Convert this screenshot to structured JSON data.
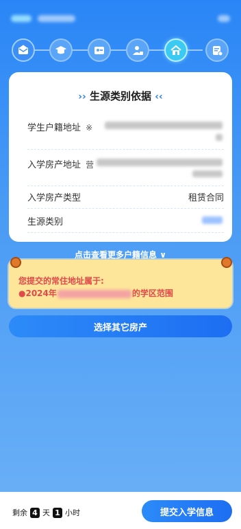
{
  "card": {
    "title": "生源类别依据",
    "rows": [
      {
        "label": "学生户籍地址",
        "value_prefix": "※"
      },
      {
        "label": "入学房产地址",
        "value_prefix": "营"
      },
      {
        "label": "入学房产类型",
        "value": "租赁合同"
      },
      {
        "label": "生源类别"
      }
    ]
  },
  "more_link": "点击查看更多户籍信息 ∨",
  "notice": {
    "line1": "您提交的常住地址属于:",
    "line2_prefix": "●2024年",
    "line2_suffix": "的学区范围"
  },
  "choose_button": "选择其它房产",
  "footer": {
    "remain_label": "剩余",
    "days": "4",
    "day_unit": "天",
    "hours": "1",
    "hour_unit": "小时",
    "submit_button": "提交入学信息"
  },
  "colors": {
    "primary": "#2d8bf8",
    "notice_bg": "#fde59a",
    "notice_text": "#e14a4a",
    "active_step": "#3ccaf3"
  },
  "steps": [
    {
      "icon": "envelope-icon",
      "state": "done"
    },
    {
      "icon": "graduation-cap-icon",
      "state": "done"
    },
    {
      "icon": "id-card-icon",
      "state": "done"
    },
    {
      "icon": "person-icon",
      "state": "done"
    },
    {
      "icon": "house-icon",
      "state": "active"
    },
    {
      "icon": "document-icon",
      "state": "pending"
    }
  ]
}
